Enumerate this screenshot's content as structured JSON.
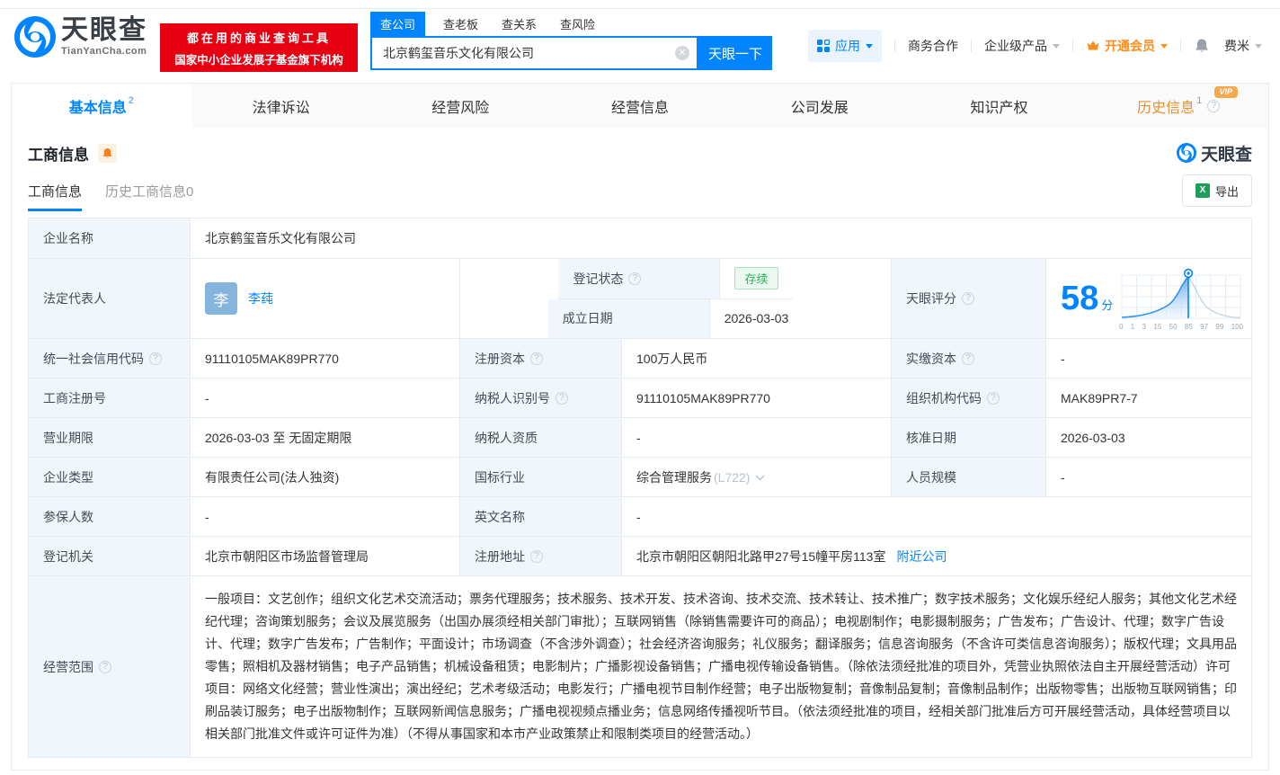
{
  "header": {
    "logo_title": "天眼查",
    "logo_domain": "TianYanCha.com",
    "slogan_line1": "都在用的商业查询工具",
    "slogan_line2": "国家中小企业发展子基金旗下机构",
    "search": {
      "tabs": [
        {
          "label": "查公司"
        },
        {
          "label": "查老板"
        },
        {
          "label": "查关系"
        },
        {
          "label": "查风险"
        }
      ],
      "value": "北京鹤玺音乐文化有限公司",
      "button": "天眼一下"
    },
    "nav": {
      "apps": "应用",
      "cooperation": "商务合作",
      "enterprise": "企业级产品",
      "vip": "开通会员",
      "user": "费米"
    }
  },
  "tabs": [
    {
      "label": "基本信息",
      "count": "2"
    },
    {
      "label": "法律诉讼"
    },
    {
      "label": "经营风险"
    },
    {
      "label": "经营信息"
    },
    {
      "label": "公司发展"
    },
    {
      "label": "知识产权"
    },
    {
      "label": "历史信息",
      "count": "1",
      "badge": "VIP"
    }
  ],
  "section": {
    "title": "工商信息",
    "watermark": "天眼查",
    "subtab_active": "工商信息",
    "subtab_history": "历史工商信息",
    "subtab_history_count": "0",
    "export_label": "导出"
  },
  "company": {
    "name_label": "企业名称",
    "name": "北京鹤玺音乐文化有限公司",
    "legal_rep_label": "法定代表人",
    "legal_rep": "李莼",
    "legal_rep_avatar": "李",
    "reg_status_label": "登记状态",
    "reg_status": "存续",
    "establish_date_label": "成立日期",
    "establish_date": "2026-03-03",
    "score_label": "天眼评分",
    "score": "58",
    "score_unit": "分",
    "score_axis": [
      "0",
      "1",
      "3",
      "15",
      "50",
      "85",
      "97",
      "99",
      "100"
    ],
    "credit_code_label": "统一社会信用代码",
    "credit_code": "91110105MAK89PR770",
    "reg_capital_label": "注册资本",
    "reg_capital": "100万人民币",
    "paid_capital_label": "实缴资本",
    "paid_capital": "-",
    "reg_number_label": "工商注册号",
    "reg_number": "-",
    "taxpayer_id_label": "纳税人识别号",
    "taxpayer_id": "91110105MAK89PR770",
    "org_code_label": "组织机构代码",
    "org_code": "MAK89PR7-7",
    "business_term_label": "营业期限",
    "business_term": "2026-03-03 至 无固定期限",
    "taxpayer_quality_label": "纳税人资质",
    "taxpayer_quality": "-",
    "approval_date_label": "核准日期",
    "approval_date": "2026-03-03",
    "company_type_label": "企业类型",
    "company_type": "有限责任公司(法人独资)",
    "industry_label": "国标行业",
    "industry": "综合管理服务",
    "industry_code": "(L722)",
    "staff_size_label": "人员规模",
    "staff_size": "-",
    "insured_label": "参保人数",
    "insured": "-",
    "english_name_label": "英文名称",
    "english_name": "-",
    "registry_label": "登记机关",
    "registry": "北京市朝阳区市场监督管理局",
    "address_label": "注册地址",
    "address": "北京市朝阳区朝阳北路甲27号15幢平房113室",
    "address_link": "附近公司",
    "scope_label": "经营范围",
    "scope": "一般项目：文艺创作；组织文化艺术交流活动；票务代理服务；技术服务、技术开发、技术咨询、技术交流、技术转让、技术推广；数字技术服务；文化娱乐经纪人服务；其他文化艺术经纪代理；咨询策划服务；会议及展览服务（出国办展须经相关部门审批）；互联网销售（除销售需要许可的商品）；电视剧制作；电影摄制服务；广告发布；广告设计、代理；数字广告设计、代理；数字广告发布；广告制作；平面设计；市场调查（不含涉外调查）；社会经济咨询服务；礼仪服务；翻译服务；信息咨询服务（不含许可类信息咨询服务）；版权代理；文具用品零售；照相机及器材销售；电子产品销售；机械设备租赁；电影制片；广播影视设备销售；广播电视传输设备销售。（除依法须经批准的项目外，凭营业执照依法自主开展经营活动）许可项目：网络文化经营；营业性演出；演出经纪；艺术考级活动；电影发行；广播电视节目制作经营；电子出版物复制；音像制品复制；音像制品制作；出版物零售；出版物互联网销售；印刷品装订服务；电子出版物制作；互联网新闻信息服务；广播电视视频点播业务；信息网络传播视听节目。（依法须经批准的项目，经相关部门批准后方可开展经营活动，具体经营项目以相关部门批准文件或许可证件为准）（不得从事国家和本市产业政策禁止和限制类项目的经营活动。）"
  }
}
